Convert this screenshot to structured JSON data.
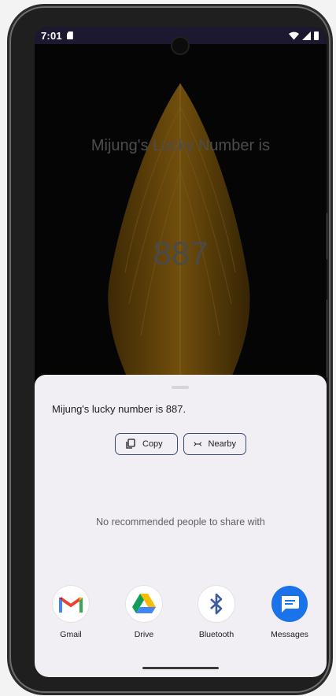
{
  "status_bar": {
    "time": "7:01"
  },
  "app": {
    "title": "Mijung's Lucky Number is",
    "number": "887"
  },
  "share_sheet": {
    "shared_text": "Mijung's lucky number is 887.",
    "copy_label": "Copy",
    "nearby_label": "Nearby",
    "no_people_text": "No recommended people to share with",
    "apps": [
      {
        "label": "Gmail",
        "icon": "gmail-icon"
      },
      {
        "label": "Drive",
        "icon": "drive-icon"
      },
      {
        "label": "Bluetooth",
        "icon": "bluetooth-icon"
      },
      {
        "label": "Messages",
        "icon": "messages-icon"
      }
    ]
  },
  "colors": {
    "sheet_bg": "#f1eff4",
    "chip_border": "#3b4a74",
    "messages_blue": "#1a73e8",
    "feather_gold": "#c98a12"
  }
}
